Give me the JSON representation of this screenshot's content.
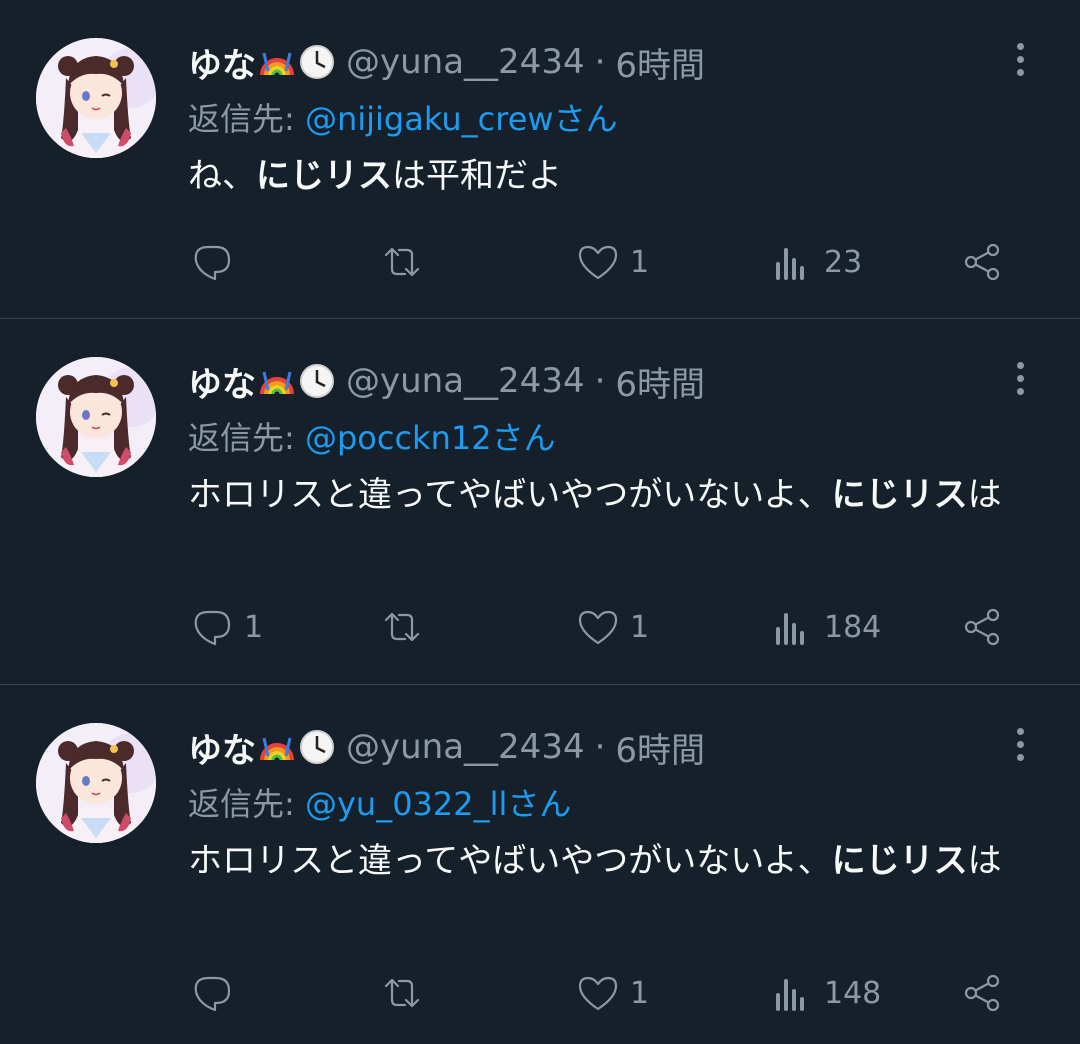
{
  "tweets": [
    {
      "name": "ゆな",
      "handle": "@yuna__2434",
      "separator": "·",
      "time": "6時間",
      "reply_prefix": "返信先: ",
      "reply_to": "@nijigaku_crew",
      "reply_suffix": "さん",
      "text_segments": [
        {
          "t": "ね、",
          "bold": false
        },
        {
          "t": "にじリス",
          "bold": true
        },
        {
          "t": "は平和だよ",
          "bold": false
        }
      ],
      "replies": "",
      "retweets": "",
      "likes": "1",
      "views": "23"
    },
    {
      "name": "ゆな",
      "handle": "@yuna__2434",
      "separator": "·",
      "time": "6時間",
      "reply_prefix": "返信先: ",
      "reply_to": "@pocckn12",
      "reply_suffix": "さん",
      "text_segments": [
        {
          "t": "ホロリスと違ってやばいやつがいないよ、",
          "bold": false
        },
        {
          "t": "にじリス",
          "bold": true
        },
        {
          "t": "は",
          "bold": false
        }
      ],
      "replies": "1",
      "retweets": "",
      "likes": "1",
      "views": "184"
    },
    {
      "name": "ゆな",
      "handle": "@yuna__2434",
      "separator": "·",
      "time": "6時間",
      "reply_prefix": "返信先: ",
      "reply_to": "@yu_0322_ll",
      "reply_suffix": "さん",
      "text_segments": [
        {
          "t": "ホロリスと違ってやばいやつがいないよ、",
          "bold": false
        },
        {
          "t": "にじリス",
          "bold": true
        },
        {
          "t": "は",
          "bold": false
        }
      ],
      "replies": "",
      "retweets": "",
      "likes": "1",
      "views": "148"
    }
  ],
  "icons": {
    "name_emojis": [
      "rainbow-icon",
      "clock-icon"
    ],
    "actions": [
      "reply-icon",
      "retweet-icon",
      "like-icon",
      "views-icon",
      "share-icon"
    ],
    "menu": "more-icon"
  },
  "colors": {
    "background": "#15202b",
    "text": "#f7f9f9",
    "muted": "#8b98a5",
    "mention": "#1d9bf0",
    "divider": "#38444d"
  }
}
